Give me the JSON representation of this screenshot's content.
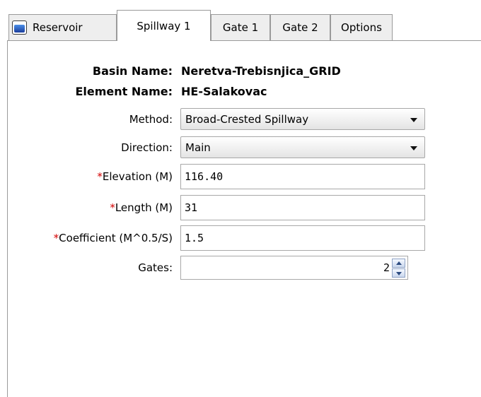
{
  "tabs": [
    {
      "label": "Reservoir",
      "icon": "reservoir-icon"
    },
    {
      "label": "Spillway 1"
    },
    {
      "label": "Gate 1"
    },
    {
      "label": "Gate 2"
    },
    {
      "label": "Options"
    }
  ],
  "active_tab": "Spillway 1",
  "info": {
    "basin_label": "Basin Name:",
    "basin_value": "Neretva-Trebisnjica_GRID",
    "element_label": "Element Name:",
    "element_value": "HE-Salakovac"
  },
  "form": {
    "required_marker": "*",
    "method": {
      "label": "Method:",
      "value": "Broad-Crested Spillway"
    },
    "direction": {
      "label": "Direction:",
      "value": "Main"
    },
    "elevation": {
      "label": "Elevation (M)",
      "value": "116.40"
    },
    "length": {
      "label": "Length (M)",
      "value": "31"
    },
    "coefficient": {
      "label": "Coefficient (M^0.5/S)",
      "value": "1.5"
    },
    "gates": {
      "label": "Gates:",
      "value": "2"
    }
  },
  "colors": {
    "required": "#d40000",
    "tab_border": "#9a9a9a"
  }
}
